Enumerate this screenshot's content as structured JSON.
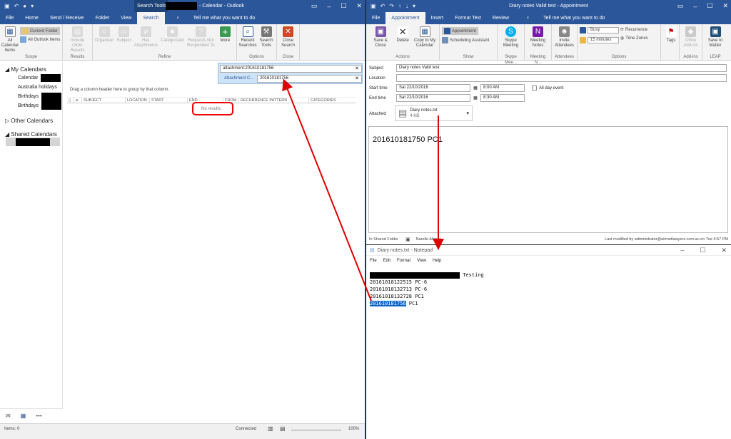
{
  "outlook": {
    "context_tab": "Search Tools",
    "title_suffix": "- Calendar - Outlook",
    "tabs": [
      "File",
      "Home",
      "Send / Receive",
      "Folder",
      "View",
      "Search"
    ],
    "tell_me": "Tell me what you want to do",
    "ribbon": {
      "scope": {
        "label": "Scope",
        "all_items": "All Calendar Items",
        "current_folder": "Current Folder",
        "all_outlook": "All Outlook Items"
      },
      "results": {
        "label": "Results",
        "include_older": "Include Older Results"
      },
      "refine": {
        "label": "Refine",
        "organizer": "Organizer",
        "subject": "Subject",
        "has_attachments": "Has Attachments",
        "categorized": "Categorized",
        "requests": "Requests Not Responded To",
        "more": "More"
      },
      "options": {
        "label": "Options",
        "recent": "Recent Searches",
        "search_tools": "Search Tools"
      },
      "close": {
        "label": "Close",
        "close_search": "Close Search"
      }
    },
    "search": {
      "query": "attachment:201610181756",
      "refine_label": "Attachment C...",
      "refine_value": "201610181756"
    },
    "nav": {
      "my_calendars": "My Calendars",
      "items": [
        "Calendar",
        "Australia holidays",
        "Birthdays",
        "Birthdays"
      ],
      "other_calendars": "Other Calendars",
      "shared_calendars": "Shared Calendars"
    },
    "group_hint": "Drag a column header here to group by that column.",
    "columns": [
      "SUBJECT",
      "LOCATION",
      "START",
      "END",
      "FROM",
      "RECURRENCE PATTERN",
      "CATEGORIES"
    ],
    "no_results": "No results.",
    "status": {
      "items": "Items: 0",
      "connected": "Connected",
      "zoom": "100%"
    }
  },
  "appointment": {
    "title": "Diary notes Valid test - Appointment",
    "tabs": [
      "File",
      "Appointment",
      "Insert",
      "Format Text",
      "Review"
    ],
    "tell_me": "Tell me what you want to do",
    "ribbon": {
      "actions": {
        "label": "Actions",
        "save_close": "Save & Close",
        "delete": "Delete",
        "copy": "Copy to My Calendar"
      },
      "show": {
        "label": "Show",
        "appointment": "Appointment",
        "scheduling": "Scheduling Assistant"
      },
      "skype": {
        "label": "Skype Mee...",
        "button": "Skype Meeting"
      },
      "meeting_notes": {
        "label": "Meeting N...",
        "button": "Meeting Notes"
      },
      "attendees": {
        "label": "Attendees",
        "button": "Invite Attendees"
      },
      "options": {
        "label": "Options",
        "busy": "Busy",
        "reminder": "15 minutes",
        "recurrence": "Recurrence",
        "time_zones": "Time Zones"
      },
      "tags": {
        "label": "",
        "button": "Tags"
      },
      "addins": {
        "label": "Add-ins",
        "button": "Office Add-ins"
      },
      "leap": {
        "label": "LEAP",
        "button": "Save to Matter"
      }
    },
    "form": {
      "subject_label": "Subject",
      "subject": "Diary notes Valid test",
      "location_label": "Location",
      "location": "",
      "start_label": "Start time",
      "start_date": "Sat 22/10/2016",
      "start_time": "8:00 AM",
      "end_label": "End time",
      "end_date": "Sat 22/10/2016",
      "end_time": "8:30 AM",
      "all_day": "All day event",
      "attached_label": "Attached",
      "file_name": "Diary notes.txt",
      "file_size": "4 KB",
      "body": "201610181750 PC1"
    },
    "footer": {
      "folder": "In Shared Folder",
      "owner": "Narelle Ahmet",
      "modified": "Last modified by administrator@ahmetlawyers.com.au on Tue 5:57 PM"
    }
  },
  "notepad": {
    "title": "Diary notes.txt - Notepad",
    "menu": [
      "File",
      "Edit",
      "Format",
      "View",
      "Help"
    ],
    "lines": {
      "l1_suffix": "Testing",
      "l2": "20161018122515 PC-6",
      "l3": "20161018132713 PC-6",
      "l4": "20161018132728 PC1",
      "l5_selected": "201610181756",
      "l5_rest": " PC1"
    }
  },
  "colors": {
    "accent": "#2b579a",
    "annotation": "#e00000",
    "selection": "#0a64c8"
  }
}
